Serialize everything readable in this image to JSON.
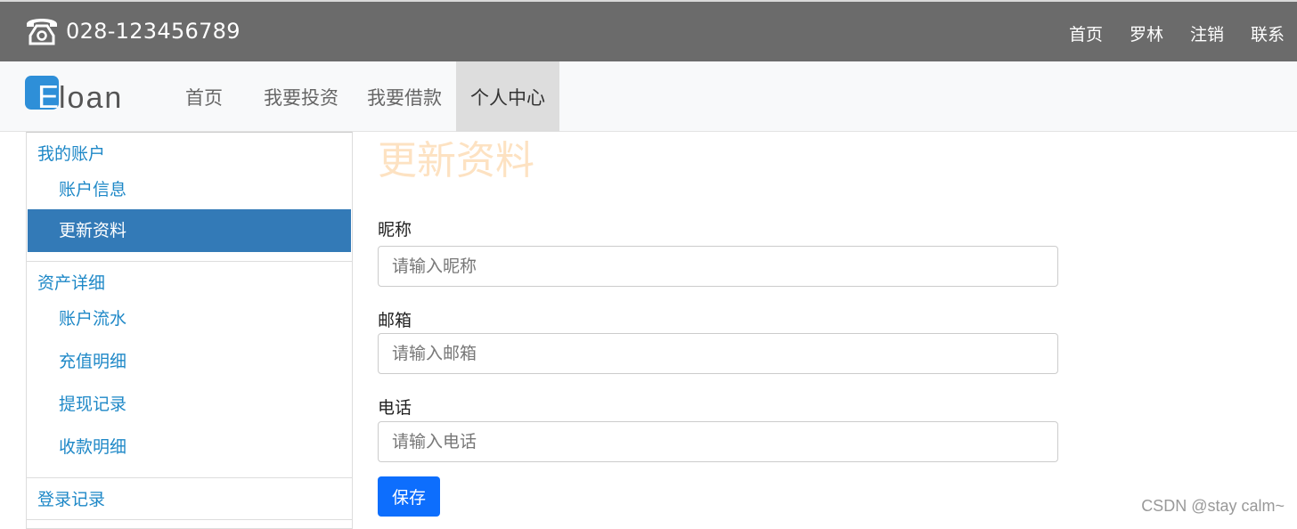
{
  "topbar": {
    "phone_number": "028-123456789",
    "links": [
      "首页",
      "罗林",
      "注销",
      "联系"
    ]
  },
  "navbar": {
    "logo_text": "Eloan",
    "items": [
      "首页",
      "我要投资",
      "我要借款",
      "个人中心"
    ],
    "active_index": 3
  },
  "sidebar": {
    "groups": [
      {
        "title": "我的账户",
        "items": [
          "账户信息",
          "更新资料"
        ]
      },
      {
        "title": "资产详细",
        "items": [
          "账户流水",
          "充值明细",
          "提现记录",
          "收款明细"
        ]
      },
      {
        "title": "登录记录",
        "items": []
      }
    ],
    "active_item": "更新资料"
  },
  "content": {
    "title": "更新资料",
    "fields": [
      {
        "label": "昵称",
        "placeholder": "请输入昵称",
        "value": ""
      },
      {
        "label": "邮箱",
        "placeholder": "请输入邮箱",
        "value": ""
      },
      {
        "label": "电话",
        "placeholder": "请输入电话",
        "value": ""
      }
    ],
    "save_label": "保存"
  },
  "watermark": "CSDN @stay calm~",
  "colors": {
    "topbar_bg": "#6b6b6b",
    "sidebar_link": "#1e88c7",
    "sidebar_active_bg": "#337ab7",
    "title_color": "#fde2c2",
    "primary_button": "#0d6efd"
  }
}
